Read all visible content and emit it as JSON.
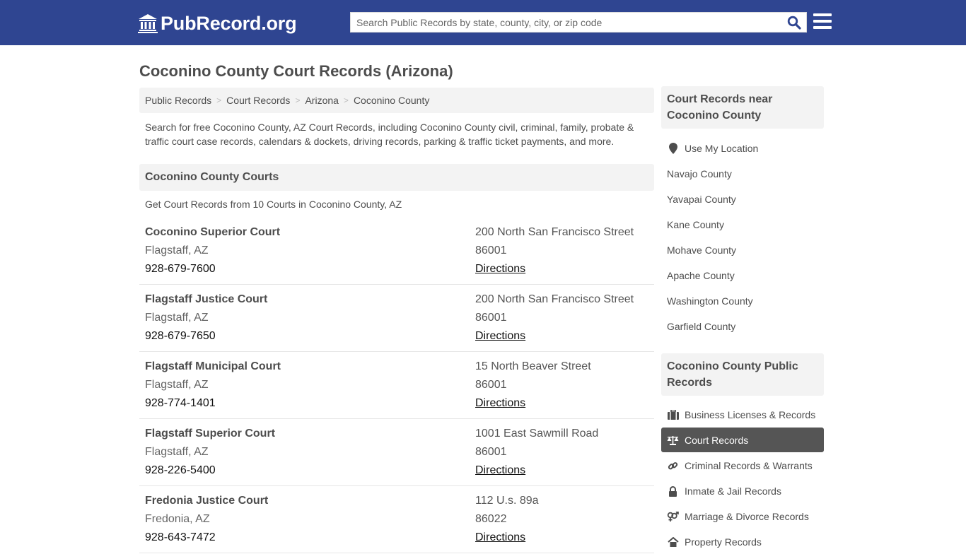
{
  "header": {
    "logo_text": "PubRecord.org",
    "search_placeholder": "Search Public Records by state, county, city, or zip code",
    "colors": {
      "topbar": "#2f4591",
      "search_icon": "#2f4591"
    }
  },
  "page": {
    "title": "Coconino County Court Records (Arizona)",
    "breadcrumb": [
      "Public Records",
      "Court Records",
      "Arizona",
      "Coconino County"
    ],
    "intro": "Search for free Coconino County, AZ Court Records, including Coconino County civil, criminal, family, probate & traffic court case records, calendars & dockets, driving records, parking & traffic ticket payments, and more.",
    "section_title": "Coconino County Courts",
    "section_subtitle": "Get Court Records from 10 Courts in Coconino County, AZ"
  },
  "courts": [
    {
      "name": "Coconino Superior Court",
      "city": "Flagstaff, AZ",
      "phone": "928-679-7600",
      "address": "200 North San Francisco Street",
      "zip": "86001",
      "directions": "Directions"
    },
    {
      "name": "Flagstaff Justice Court",
      "city": "Flagstaff, AZ",
      "phone": "928-679-7650",
      "address": "200 North San Francisco Street",
      "zip": "86001",
      "directions": "Directions"
    },
    {
      "name": "Flagstaff Municipal Court",
      "city": "Flagstaff, AZ",
      "phone": "928-774-1401",
      "address": "15 North Beaver Street",
      "zip": "86001",
      "directions": "Directions"
    },
    {
      "name": "Flagstaff Superior Court",
      "city": "Flagstaff, AZ",
      "phone": "928-226-5400",
      "address": "1001 East Sawmill Road",
      "zip": "86001",
      "directions": "Directions"
    },
    {
      "name": "Fredonia Justice Court",
      "city": "Fredonia, AZ",
      "phone": "928-643-7472",
      "address": "112 U.s. 89a",
      "zip": "86022",
      "directions": "Directions"
    }
  ],
  "sidebar": {
    "nearby_title": "Court Records near Coconino County",
    "use_location": "Use My Location",
    "nearby": [
      "Navajo County",
      "Yavapai County",
      "Kane County",
      "Mohave County",
      "Apache County",
      "Washington County",
      "Garfield County"
    ],
    "public_title": "Coconino County Public Records",
    "public_records": [
      {
        "label": "Business Licenses & Records",
        "icon": "briefcase-icon",
        "active": false
      },
      {
        "label": "Court Records",
        "icon": "balance-scale-icon",
        "active": true
      },
      {
        "label": "Criminal Records & Warrants",
        "icon": "link-icon",
        "active": false
      },
      {
        "label": "Inmate & Jail Records",
        "icon": "lock-icon",
        "active": false
      },
      {
        "label": "Marriage & Divorce Records",
        "icon": "venus-mars-icon",
        "active": false
      },
      {
        "label": "Property Records",
        "icon": "home-icon",
        "active": false
      }
    ],
    "active_color": "#555555"
  }
}
